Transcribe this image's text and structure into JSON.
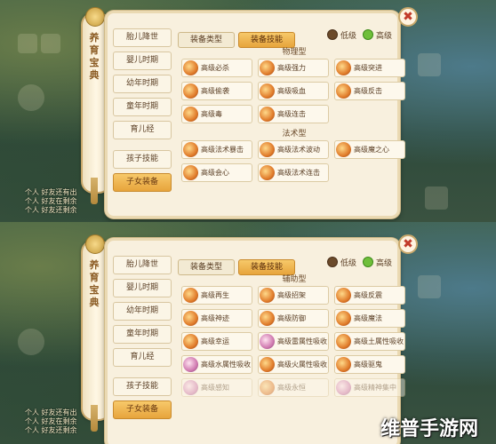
{
  "top": {
    "scroll_title": [
      "养",
      "育",
      "宝",
      "典"
    ],
    "sidebar": [
      "胎儿降世",
      "婴儿时期",
      "幼年时期",
      "童年时期",
      "育儿经",
      "孩子技能",
      "子女装备"
    ],
    "tabs": [
      "装备类型",
      "装备技能"
    ],
    "radio": {
      "low": "低级",
      "high": "高级"
    },
    "sections": [
      {
        "header": "物理型",
        "skills": [
          {
            "name": "高级必杀",
            "icon": "fire-icon"
          },
          {
            "name": "高级强力",
            "icon": "fire-icon"
          },
          {
            "name": "高级突进",
            "icon": "fire-icon"
          },
          {
            "name": "高级偷袭",
            "icon": "fire-icon"
          },
          {
            "name": "高级吸血",
            "icon": "fire-icon"
          },
          {
            "name": "高级反击",
            "icon": "fire-icon"
          },
          {
            "name": "高级毒",
            "icon": "fire-icon"
          },
          {
            "name": "高级连击",
            "icon": "fire-icon"
          }
        ]
      },
      {
        "header": "法术型",
        "skills": [
          {
            "name": "高级法术暴击",
            "icon": "fire-icon"
          },
          {
            "name": "高级法术波动",
            "icon": "fire-icon"
          },
          {
            "name": "高级魔之心",
            "icon": "fire-icon"
          },
          {
            "name": "高级会心",
            "icon": "fire-icon"
          },
          {
            "name": "高级法术连击",
            "icon": "fire-icon"
          }
        ]
      }
    ],
    "chat": [
      "个人 好友还有出",
      "个人 好友在剩余",
      "个人 好友还剩余"
    ]
  },
  "bottom": {
    "scroll_title": [
      "养",
      "育",
      "宝",
      "典"
    ],
    "sidebar": [
      "胎儿降世",
      "婴儿时期",
      "幼年时期",
      "童年时期",
      "育儿经",
      "孩子技能",
      "子女装备"
    ],
    "tabs": [
      "装备类型",
      "装备技能"
    ],
    "radio": {
      "low": "低级",
      "high": "高级"
    },
    "sections": [
      {
        "header": "辅助型",
        "skills": [
          {
            "name": "高级再生",
            "icon": "fire-icon"
          },
          {
            "name": "高级招架",
            "icon": "fire-icon"
          },
          {
            "name": "高级反震",
            "icon": "fire-icon"
          },
          {
            "name": "高级神迹",
            "icon": "fire-icon"
          },
          {
            "name": "高级防御",
            "icon": "fire-icon"
          },
          {
            "name": "高级魔法",
            "icon": "fire-icon"
          },
          {
            "name": "高级幸运",
            "icon": "fire-icon"
          },
          {
            "name": "高级雷属性吸收",
            "icon": "pink-orb-icon"
          },
          {
            "name": "高级土属性吸收",
            "icon": "fire-icon"
          },
          {
            "name": "高级水属性吸收",
            "icon": "pink-orb-icon"
          },
          {
            "name": "高级火属性吸收",
            "icon": "fire-icon"
          },
          {
            "name": "高级驱鬼",
            "icon": "fire-icon"
          },
          {
            "name": "高级感知",
            "icon": "pink-orb-icon"
          },
          {
            "name": "高级永恒",
            "icon": "fire-icon"
          },
          {
            "name": "高级精神集中",
            "icon": "pink-orb-icon"
          }
        ]
      }
    ],
    "chat": [
      "个人 好友还有出",
      "个人 好友在剩余",
      "个人 好友还剩余"
    ]
  },
  "watermark": "维普手游网",
  "close_symbol": "✖"
}
